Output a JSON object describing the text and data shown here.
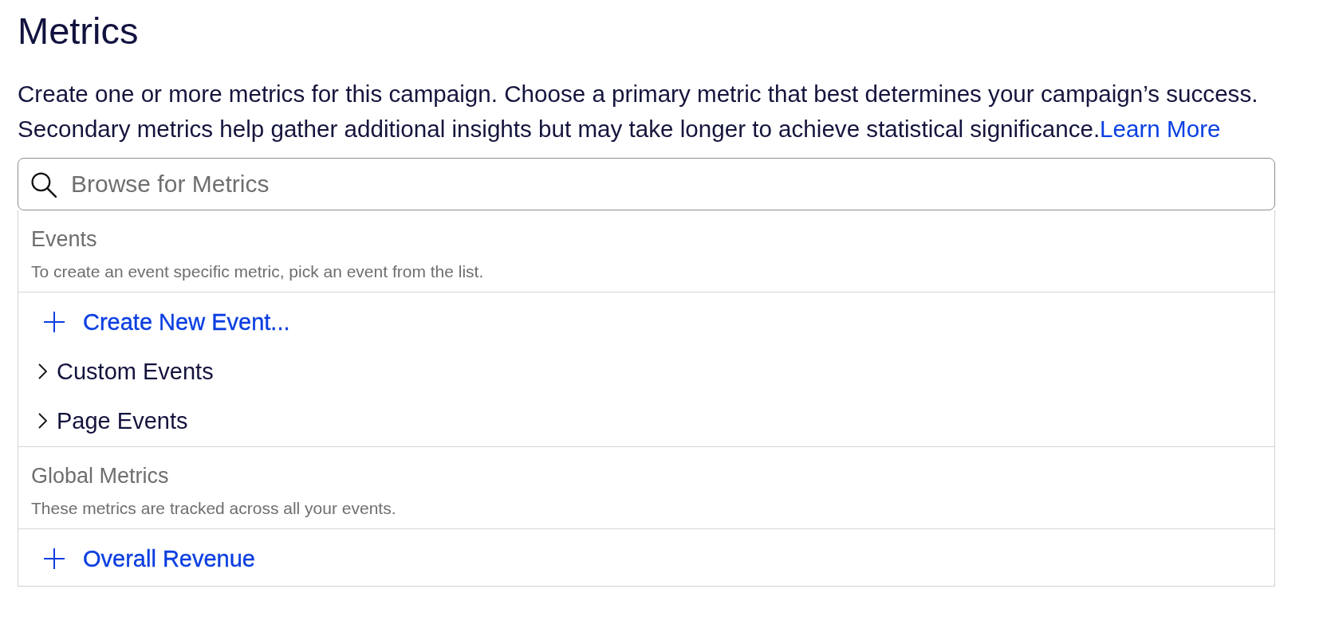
{
  "title": "Metrics",
  "description": {
    "text": "Create one or more metrics for this campaign. Choose a primary metric that best determines your campaign’s success. Secondary metrics help gather additional insights but may take longer to achieve statistical significance.",
    "link": "Learn More"
  },
  "search": {
    "placeholder": "Browse for Metrics"
  },
  "sections": [
    {
      "heading": "Events",
      "hint": "To create an event specific metric, pick an event from the list.",
      "items": [
        {
          "kind": "action",
          "label": "Create New Event..."
        },
        {
          "kind": "group",
          "label": "Custom Events",
          "expanded": false
        },
        {
          "kind": "group",
          "label": "Page Events",
          "expanded": false
        }
      ]
    },
    {
      "heading": "Global Metrics",
      "hint": "These metrics are tracked across all your events.",
      "items": [
        {
          "kind": "action",
          "label": "Overall Revenue"
        }
      ]
    }
  ]
}
